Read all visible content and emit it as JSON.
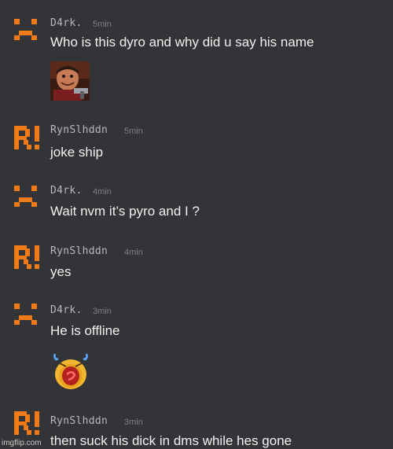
{
  "messages": [
    {
      "user": "D4rk.",
      "time": "5min",
      "text": "Who is this dyro and why did u say his name",
      "avatar": "sad-face-icon",
      "attachment": "meme-image-man-with-gun"
    },
    {
      "user": "RynSlhddn",
      "time": "5min",
      "text": "joke ship",
      "avatar": "r-exclaim-icon"
    },
    {
      "user": "D4rk.",
      "time": "4min",
      "text": "Wait nvm it’s pyro and I ?",
      "avatar": "sad-face-icon"
    },
    {
      "user": "RynSlhddn",
      "time": "4min",
      "text": "yes",
      "avatar": "r-exclaim-icon"
    },
    {
      "user": "D4rk.",
      "time": "3min",
      "text": "He is offline",
      "avatar": "sad-face-icon",
      "attachment": "crying-emoji-sticker"
    },
    {
      "user": "RynSlhddn",
      "time": "3min",
      "text": "then suck his dick in dms while hes gone",
      "avatar": "r-exclaim-icon"
    }
  ],
  "watermark": "imgflip.com",
  "colors": {
    "background": "#333437",
    "avatar_orange": "#f07a16",
    "text": "#f1f1f1",
    "username": "#b9b9bd",
    "timestamp": "#7e7f83"
  }
}
